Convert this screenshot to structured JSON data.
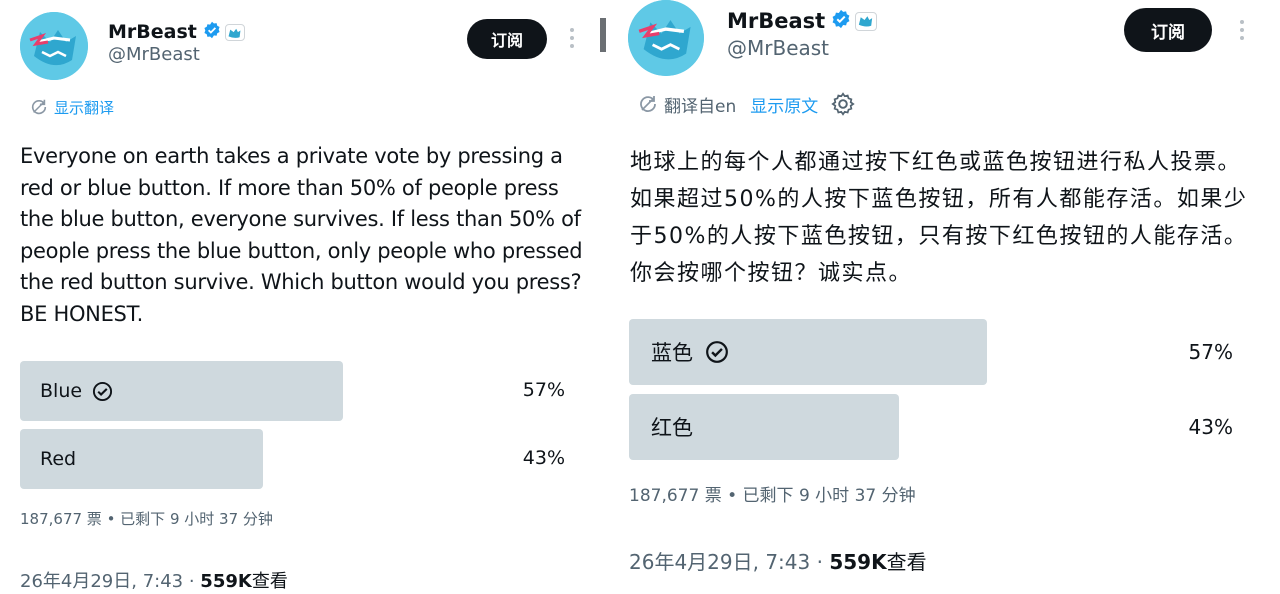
{
  "left": {
    "name": "MrBeast",
    "handle": "@MrBeast",
    "subscribe_label": "订阅",
    "translate_label": "显示翻译",
    "tweet_text": "Everyone on earth takes a private vote by pressing a red or blue button. If more than 50% of people press the blue button, everyone survives. If less than 50% of people press the blue button, only people who pressed the red button survive. Which button would you press? BE HONEST.",
    "poll": [
      {
        "label": "Blue",
        "pct_label": "57%",
        "value": 57,
        "selected": true
      },
      {
        "label": "Red",
        "pct_label": "43%",
        "value": 43,
        "selected": false
      }
    ],
    "poll_meta": "187,677 票 • 已剩下 9 小时 37 分钟",
    "timestamp": "26年4月29日, 7:43 · ",
    "views_count": "559K",
    "views_label": "查看"
  },
  "right": {
    "name": "MrBeast",
    "handle": "@MrBeast",
    "subscribe_label": "订阅",
    "translated_from": "翻译自en",
    "show_original": "显示原文",
    "tweet_text": "地球上的每个人都通过按下红色或蓝色按钮进行私人投票。如果超过50%的人按下蓝色按钮，所有人都能存活。如果少于50%的人按下蓝色按钮，只有按下红色按钮的人能存活。你会按哪个按钮？诚实点。",
    "poll": [
      {
        "label": "蓝色",
        "pct_label": "57%",
        "value": 57,
        "selected": true
      },
      {
        "label": "红色",
        "pct_label": "43%",
        "value": 43,
        "selected": false
      }
    ],
    "poll_meta": "187,677 票 • 已剩下 9 小时 37 分钟",
    "timestamp": "26年4月29日, 7:43 · ",
    "views_count": "559K",
    "views_label": "查看"
  },
  "colors": {
    "verified": "#1d9bf0",
    "poll_bar": "#cfd9de",
    "link": "#1d9bf0",
    "secondary_text": "#536471",
    "avatar_bg": "#5fc9e6"
  },
  "icons": [
    "verified-badge-icon",
    "beast-affiliate-icon",
    "translate-icon",
    "gear-icon",
    "check-circle-icon",
    "more-icon"
  ]
}
